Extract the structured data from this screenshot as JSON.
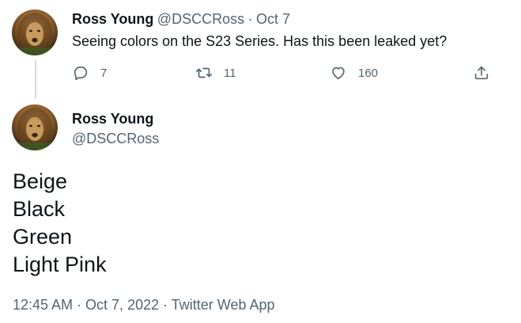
{
  "first_tweet": {
    "display_name": "Ross Young",
    "handle": "@DSCCRoss",
    "separator": "·",
    "date": "Oct 7",
    "text": "Seeing colors on the S23 Series. Has this been leaked yet?",
    "replies": "7",
    "retweets": "11",
    "likes": "160"
  },
  "main_tweet": {
    "display_name": "Ross Young",
    "handle": "@DSCCRoss",
    "lines": [
      "Beige",
      "Black",
      "Green",
      "Light Pink"
    ],
    "timestamp": "12:45 AM · Oct 7, 2022 · Twitter Web App"
  },
  "icons": {
    "reply": "reply-icon",
    "retweet": "retweet-icon",
    "like": "heart-icon",
    "share": "share-icon"
  },
  "colors": {
    "text": "#0f1419",
    "muted": "#536471",
    "thread_line": "#cfd9de"
  }
}
